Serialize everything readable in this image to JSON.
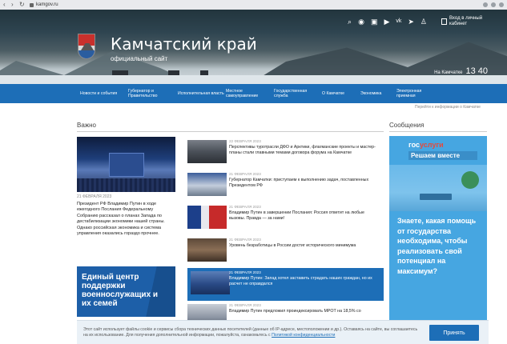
{
  "browser": {
    "url": "kamgov.ru"
  },
  "header": {
    "title": "Камчатский край",
    "subtitle": "официальный сайт",
    "cabinet": "Вход в личный кабинет",
    "time_label": "На Камчатке",
    "time": "13 40",
    "icons": [
      "search-icon",
      "eye-icon",
      "rutube-icon",
      "youtube-icon",
      "vk-icon",
      "telegram-icon",
      "odnoklassniki-icon"
    ]
  },
  "nav": {
    "items": [
      "Новости и события",
      "Губернатор и Правительство",
      "Исполнительная власть",
      "Местное самоуправление",
      "Государственная служба",
      "О Камчатке",
      "Экономика",
      "Электронная приемная"
    ]
  },
  "breadcrumb": "Перейти к информации о Камчатке",
  "important": {
    "title": "Важно",
    "feature": {
      "date": "21 ФЕВРАЛЯ 2023",
      "text": "Президент РФ Владимир Путин в ходе ежегодного Послания Федеральному Собранию рассказал о планах Запада по дестабилизации экономики нашей страны. Однако российская экономика и система управления оказались гораздо прочнее."
    },
    "news": [
      {
        "date": "22 ФЕВРАЛЯ 2023",
        "title": "Перспективы туротрасли ДФО и Арктики, флагманские проекты и мастер-планы стали главными темами договора форума на Камчатке"
      },
      {
        "date": "21 ФЕВРАЛЯ 2023",
        "title": "Губернатор Камчатки: приступаем к выполнению задач, поставленных Президентом РФ"
      },
      {
        "date": "21 ФЕВРАЛЯ 2023",
        "title": "Владимир Путин в завершении Послания: Россия ответит на любые вызовы. Правда — за нами!"
      },
      {
        "date": "21 ФЕВРАЛЯ 2023",
        "title": "Уровень безработицы в России достиг исторического минимума"
      },
      {
        "date": "21 ФЕВРАЛЯ 2023",
        "title": "Владимир Путин: Запад хотел заставить страдать наших граждан, но их расчет не оправдался"
      },
      {
        "date": "21 ФЕВРАЛЯ 2023",
        "title": "Владимир Путин предложил проиндексировать МРОТ на 18,5% со"
      }
    ],
    "promo": "Единый центр поддержки военнослужащих и их семей"
  },
  "messages": {
    "title": "Сообщения",
    "gos_logo_a": "гос",
    "gos_logo_b": "услуги",
    "slogan": "Решаем вместе",
    "text": "Знаете, какая помощь от государства необходима, чтобы реализовать свой потенциал на максимум?"
  },
  "cookie": {
    "text": "Этот сайт использует файлы cookie и сервисы сбора технических данных посетителей (данные об IP-адресе, местоположении и др.). Оставаясь на сайте, вы соглашаетесь на их использование. Для получения дополнительной информации, пожалуйста, ознакомьтесь с",
    "link": "Политикой конфиденциальности",
    "button": "Принять"
  }
}
